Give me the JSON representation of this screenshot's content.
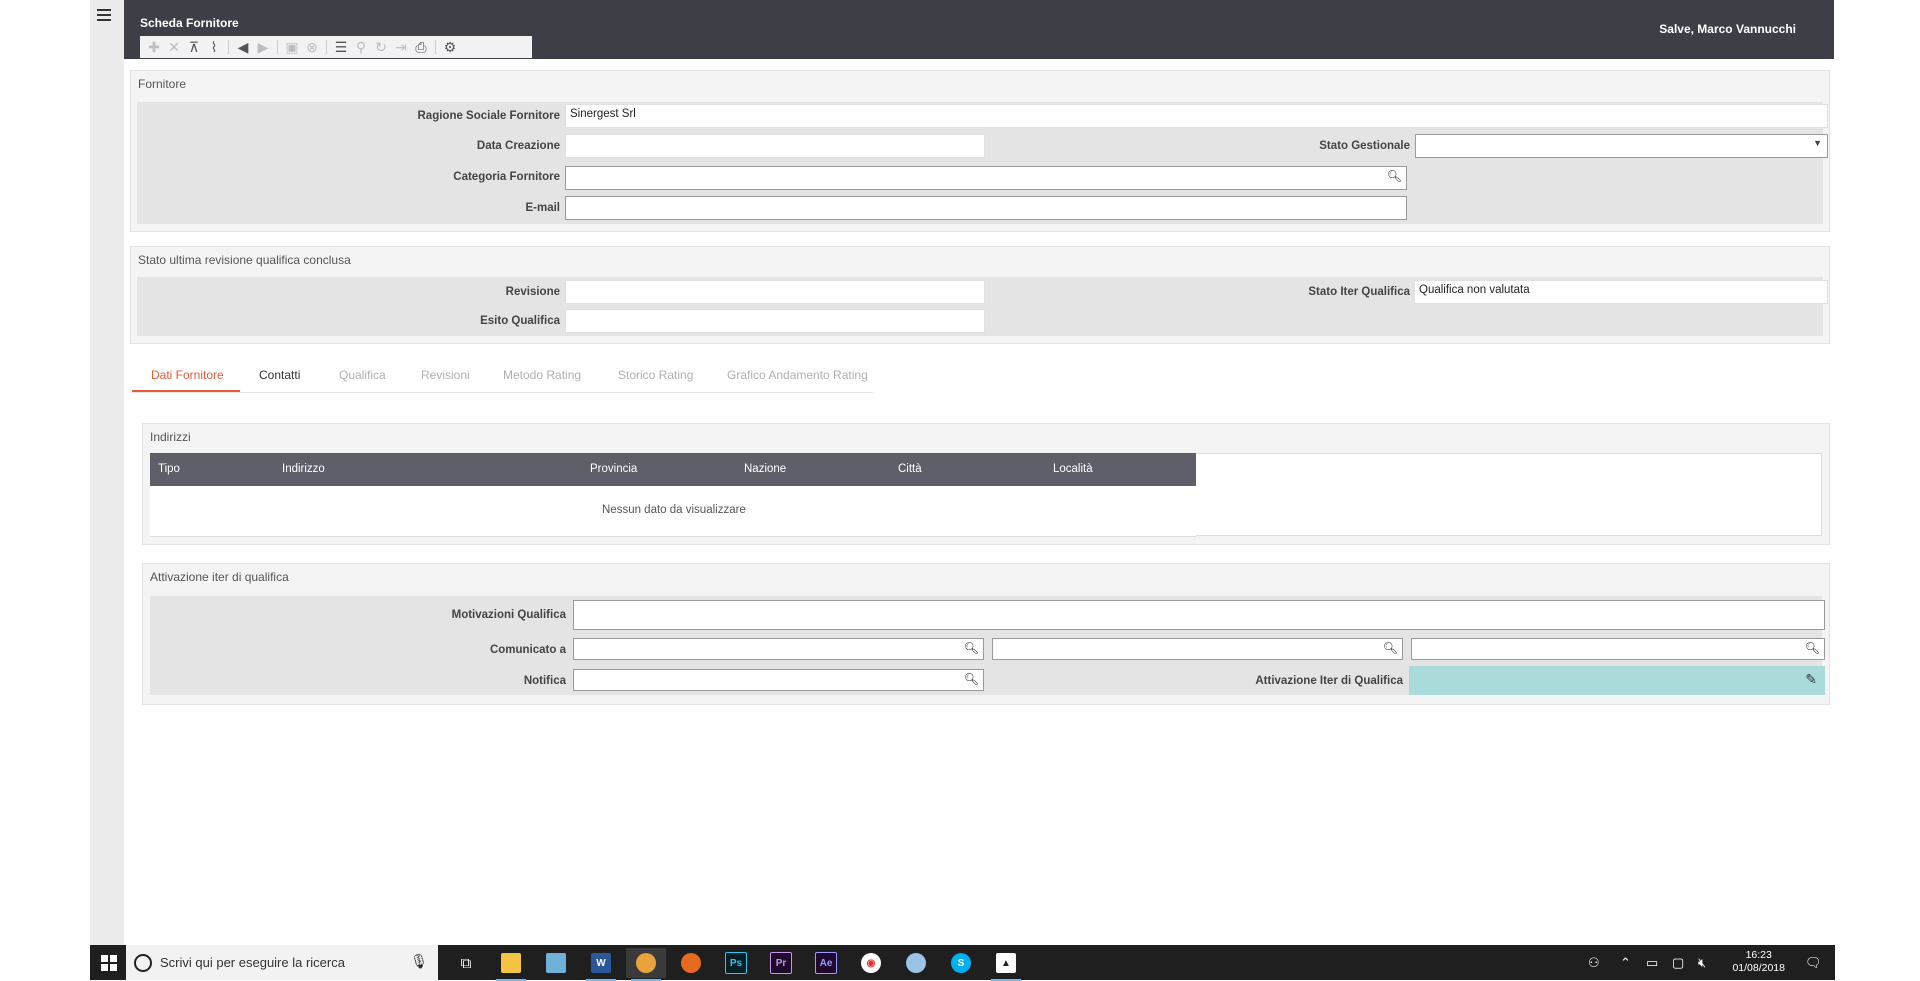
{
  "header": {
    "title": "Scheda Fornitore",
    "user_greeting": "Salve, Marco Vannucchi"
  },
  "toolbar_icons": [
    "plus-icon",
    "cross-icon",
    "hierarchy-icon",
    "paperclip-icon",
    "arrow-left-icon",
    "arrow-right-icon",
    "save-icon",
    "cancel-circle-icon",
    "list-icon",
    "filter-icon",
    "refresh-icon",
    "export-icon",
    "print-icon",
    "gear-icon"
  ],
  "fornitore": {
    "title": "Fornitore",
    "ragione_sociale_label": "Ragione Sociale Fornitore",
    "ragione_sociale_value": "Sinergest Srl",
    "data_creazione_label": "Data Creazione",
    "data_creazione_value": "",
    "stato_gestionale_label": "Stato Gestionale",
    "stato_gestionale_value": "",
    "categoria_label": "Categoria Fornitore",
    "categoria_value": "",
    "email_label": "E-mail",
    "email_value": ""
  },
  "revisione": {
    "title": "Stato ultima revisione qualifica conclusa",
    "revisione_label": "Revisione",
    "revisione_value": "",
    "esito_label": "Esito Qualifica",
    "esito_value": "",
    "stato_iter_label": "Stato Iter Qualifica",
    "stato_iter_value": "Qualifica non valutata"
  },
  "tabs": [
    {
      "label": "Dati Fornitore",
      "state": "active"
    },
    {
      "label": "Contatti",
      "state": "enabled"
    },
    {
      "label": "Qualifica",
      "state": "disabled"
    },
    {
      "label": "Revisioni",
      "state": "disabled"
    },
    {
      "label": "Metodo Rating",
      "state": "disabled"
    },
    {
      "label": "Storico Rating",
      "state": "disabled"
    },
    {
      "label": "Grafico Andamento Rating",
      "state": "disabled"
    }
  ],
  "indirizzi": {
    "title": "Indirizzi",
    "columns": [
      "Tipo",
      "Indirizzo",
      "Provincia",
      "Nazione",
      "Città",
      "Località"
    ],
    "empty_message": "Nessun dato da visualizzare"
  },
  "attivazione": {
    "title": "Attivazione iter di qualifica",
    "motivazioni_label": "Motivazioni Qualifica",
    "motivazioni_value": "",
    "comunicato_label": "Comunicato a",
    "comunicato_values": [
      "",
      "",
      ""
    ],
    "notifica_label": "Notifica",
    "notifica_value": "",
    "attivazione_label": "Attivazione Iter di Qualifica",
    "accent_color": "#a9dbdb"
  },
  "taskbar": {
    "search_placeholder": "Scrivi qui per eseguire la ricerca",
    "apps": [
      "task-view",
      "file-explorer",
      "notepad",
      "word",
      "chrome",
      "firefox",
      "photoshop",
      "premiere",
      "after-effects",
      "app-red",
      "paint",
      "skype",
      "photos"
    ],
    "time": "16:23",
    "date": "01/08/2018"
  }
}
